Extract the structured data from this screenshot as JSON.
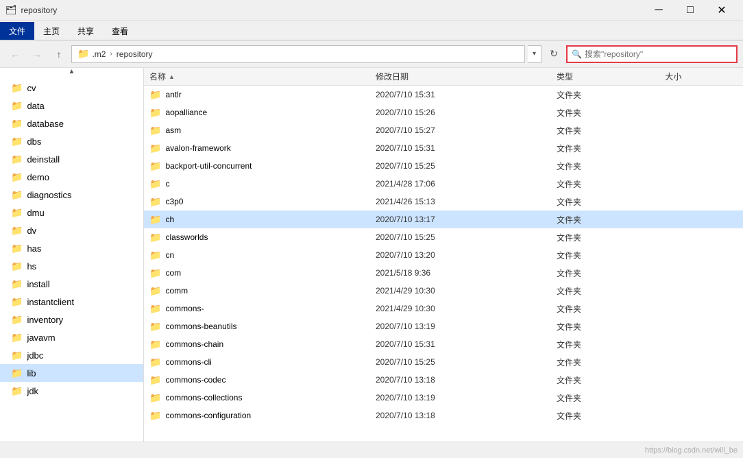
{
  "titleBar": {
    "icon": "🗂",
    "title": "repository",
    "minBtn": "─",
    "maxBtn": "□",
    "closeBtn": "✕"
  },
  "ribbon": {
    "tabs": [
      {
        "label": "文件",
        "active": true
      },
      {
        "label": "主页",
        "active": false
      },
      {
        "label": "共享",
        "active": false
      },
      {
        "label": "查看",
        "active": false
      }
    ]
  },
  "addressBar": {
    "backBtn": "←",
    "forwardBtn": "→",
    "upBtn": "↑",
    "pathParts": [
      ".m2",
      "repository"
    ],
    "refreshBtn": "↻",
    "searchPlaceholder": "搜索\"repository\""
  },
  "sidebar": {
    "items": [
      {
        "label": "cv",
        "selected": false
      },
      {
        "label": "data",
        "selected": false
      },
      {
        "label": "database",
        "selected": false
      },
      {
        "label": "dbs",
        "selected": false
      },
      {
        "label": "deinstall",
        "selected": false
      },
      {
        "label": "demo",
        "selected": false
      },
      {
        "label": "diagnostics",
        "selected": false
      },
      {
        "label": "dmu",
        "selected": false
      },
      {
        "label": "dv",
        "selected": false
      },
      {
        "label": "has",
        "selected": false
      },
      {
        "label": "hs",
        "selected": false
      },
      {
        "label": "install",
        "selected": false
      },
      {
        "label": "instantclient",
        "selected": false
      },
      {
        "label": "inventory",
        "selected": false
      },
      {
        "label": "javavm",
        "selected": false
      },
      {
        "label": "jdbc",
        "selected": false
      },
      {
        "label": "lib",
        "selected": true
      },
      {
        "label": "jdk",
        "selected": false
      }
    ]
  },
  "fileList": {
    "headers": {
      "name": "名称",
      "date": "修改日期",
      "type": "类型",
      "size": "大小"
    },
    "files": [
      {
        "name": "antlr",
        "date": "2020/7/10 15:31",
        "type": "文件夹",
        "size": "",
        "selected": false
      },
      {
        "name": "aopalliance",
        "date": "2020/7/10 15:26",
        "type": "文件夹",
        "size": "",
        "selected": false
      },
      {
        "name": "asm",
        "date": "2020/7/10 15:27",
        "type": "文件夹",
        "size": "",
        "selected": false
      },
      {
        "name": "avalon-framework",
        "date": "2020/7/10 15:31",
        "type": "文件夹",
        "size": "",
        "selected": false
      },
      {
        "name": "backport-util-concurrent",
        "date": "2020/7/10 15:25",
        "type": "文件夹",
        "size": "",
        "selected": false
      },
      {
        "name": "c",
        "date": "2021/4/28 17:06",
        "type": "文件夹",
        "size": "",
        "selected": false
      },
      {
        "name": "c3p0",
        "date": "2021/4/26 15:13",
        "type": "文件夹",
        "size": "",
        "selected": false
      },
      {
        "name": "ch",
        "date": "2020/7/10 13:17",
        "type": "文件夹",
        "size": "",
        "selected": true
      },
      {
        "name": "classworlds",
        "date": "2020/7/10 15:25",
        "type": "文件夹",
        "size": "",
        "selected": false
      },
      {
        "name": "cn",
        "date": "2020/7/10 13:20",
        "type": "文件夹",
        "size": "",
        "selected": false
      },
      {
        "name": "com",
        "date": "2021/5/18 9:36",
        "type": "文件夹",
        "size": "",
        "selected": false
      },
      {
        "name": "comm",
        "date": "2021/4/29 10:30",
        "type": "文件夹",
        "size": "",
        "selected": false
      },
      {
        "name": "commons-",
        "date": "2021/4/29 10:30",
        "type": "文件夹",
        "size": "",
        "selected": false
      },
      {
        "name": "commons-beanutils",
        "date": "2020/7/10 13:19",
        "type": "文件夹",
        "size": "",
        "selected": false
      },
      {
        "name": "commons-chain",
        "date": "2020/7/10 15:31",
        "type": "文件夹",
        "size": "",
        "selected": false
      },
      {
        "name": "commons-cli",
        "date": "2020/7/10 15:25",
        "type": "文件夹",
        "size": "",
        "selected": false
      },
      {
        "name": "commons-codec",
        "date": "2020/7/10 13:18",
        "type": "文件夹",
        "size": "",
        "selected": false
      },
      {
        "name": "commons-collections",
        "date": "2020/7/10 13:19",
        "type": "文件夹",
        "size": "",
        "selected": false
      },
      {
        "name": "commons-configuration",
        "date": "2020/7/10 13:18",
        "type": "文件夹",
        "size": "",
        "selected": false
      }
    ]
  },
  "statusBar": {
    "watermark": "https://blog.csdn.net/will_be"
  }
}
